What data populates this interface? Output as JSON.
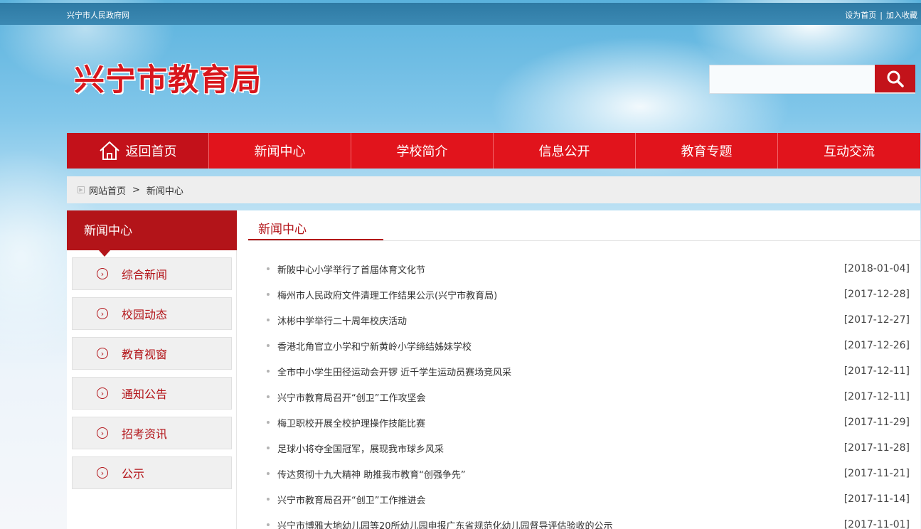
{
  "topbar": {
    "site_name": "兴宁市人民政府网",
    "set_home": "设为首页",
    "separator": "|",
    "add_favorite": "加入收藏"
  },
  "header": {
    "logo_text": "兴宁市教育局",
    "search": {
      "placeholder": "",
      "value": "",
      "button_icon": "search-icon"
    }
  },
  "nav": {
    "home_icon": "home-icon",
    "items": [
      "返回首页",
      "新闻中心",
      "学校简介",
      "信息公开",
      "教育专题",
      "互动交流"
    ]
  },
  "breadcrumb": {
    "home": "网站首页",
    "separator": ">",
    "current": "新闻中心"
  },
  "sidebar": {
    "title": "新闻中心",
    "item_icon": "circle-arrow-right-icon",
    "items": [
      "综合新闻",
      "校园动态",
      "教育视窗",
      "通知公告",
      "招考资讯",
      "公示"
    ]
  },
  "main": {
    "title": "新闻中心",
    "news": [
      {
        "title": "新陂中心小学举行了首届体育文化节",
        "date": "[2018-01-04]"
      },
      {
        "title": "梅州市人民政府文件清理工作结果公示(兴宁市教育局)",
        "date": "[2017-12-28]"
      },
      {
        "title": "沐彬中学举行二十周年校庆活动",
        "date": "[2017-12-27]"
      },
      {
        "title": "香港北角官立小学和宁新黄岭小学缔结姊妹学校",
        "date": "[2017-12-26]"
      },
      {
        "title": "全市中小学生田径运动会开锣 近千学生运动员赛场竞风采",
        "date": "[2017-12-11]"
      },
      {
        "title": "兴宁市教育局召开“创卫”工作攻坚会",
        "date": "[2017-12-11]"
      },
      {
        "title": "梅卫职校开展全校护理操作技能比赛",
        "date": "[2017-11-29]"
      },
      {
        "title": "足球小将夺全国冠军，展现我市球乡风采",
        "date": "[2017-11-28]"
      },
      {
        "title": "传达贯彻十九大精神 助推我市教育“创强争先”",
        "date": "[2017-11-21]"
      },
      {
        "title": "兴宁市教育局召开“创卫”工作推进会",
        "date": "[2017-11-14]"
      },
      {
        "title": "兴宁市博雅大地幼儿园等20所幼儿园申报广东省规范化幼儿园督导评估验收的公示",
        "date": "[2017-11-01]"
      }
    ]
  },
  "colors": {
    "brand_red": "#e1141c",
    "dark_red": "#b31419",
    "topbar_blue": "#2e7aa4"
  }
}
